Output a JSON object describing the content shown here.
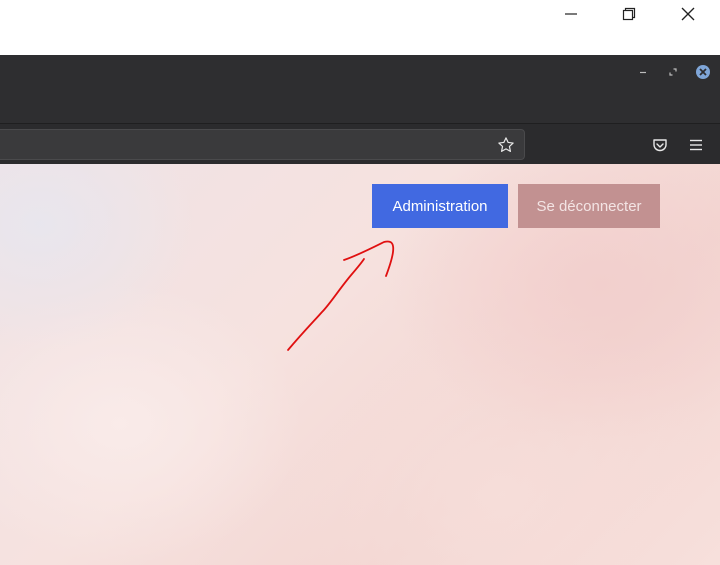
{
  "os_window": {
    "controls": [
      "minimize-icon",
      "restore-icon",
      "close-icon"
    ]
  },
  "browser": {
    "tab_controls": [
      "minimize-icon",
      "maximize-icon",
      "close-icon"
    ],
    "toolbar_icons": [
      "star-icon",
      "pocket-icon",
      "hamburger-menu-icon"
    ]
  },
  "page": {
    "admin_label": "Administration",
    "logout_label": "Se déconnecter"
  },
  "colors": {
    "admin_button": "#4169e1",
    "logout_button": "#c29191",
    "annotation_arrow": "#e01010",
    "close_badge": "#7fa6d8"
  }
}
